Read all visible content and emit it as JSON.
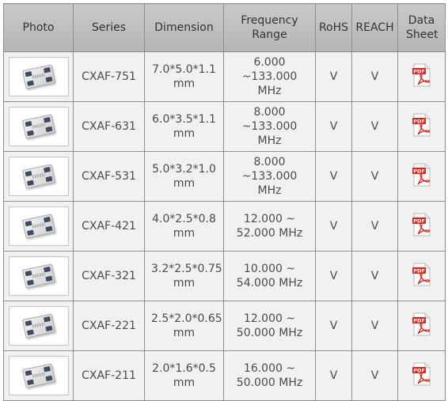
{
  "table": {
    "headers": [
      "Photo",
      "Series",
      "Dimension",
      "Frequency Range",
      "RoHS",
      "REACH",
      "Data Sheet"
    ],
    "rows": [
      {
        "series": "CXAF-751",
        "dimension": "7.0*5.0*1.1 mm",
        "frequency": "6.000 ~133.000 MHz",
        "rohs": "V",
        "reach": "V"
      },
      {
        "series": "CXAF-631",
        "dimension": "6.0*3.5*1.1 mm",
        "frequency": "8.000 ~133.000 MHz",
        "rohs": "V",
        "reach": "V"
      },
      {
        "series": "CXAF-531",
        "dimension": "5.0*3.2*1.0 mm",
        "frequency": "8.000 ~133.000 MHz",
        "rohs": "V",
        "reach": "V"
      },
      {
        "series": "CXAF-421",
        "dimension": "4.0*2.5*0.8 mm",
        "frequency": "12.000 ~ 52.000 MHz",
        "rohs": "V",
        "reach": "V"
      },
      {
        "series": "CXAF-321",
        "dimension": "3.2*2.5*0.75 mm",
        "frequency": "10.000 ~ 54.000 MHz",
        "rohs": "V",
        "reach": "V"
      },
      {
        "series": "CXAF-221",
        "dimension": "2.5*2.0*0.65 mm",
        "frequency": "12.000 ~ 50.000 MHz",
        "rohs": "V",
        "reach": "V"
      },
      {
        "series": "CXAF-211",
        "dimension": "2.0*1.6*0.5 mm",
        "frequency": "16.000 ~ 50.000 MHz",
        "rohs": "V",
        "reach": "V"
      }
    ]
  },
  "icons": {
    "photo": "crystal-oscillator-photo",
    "datasheet": "pdf-icon",
    "pdf_text": "PDF"
  },
  "colors": {
    "header_bg": "#bfbfbf",
    "cell_bg": "#f1f1f1",
    "border": "#8e8e8e",
    "pdf_red": "#d9261c"
  }
}
